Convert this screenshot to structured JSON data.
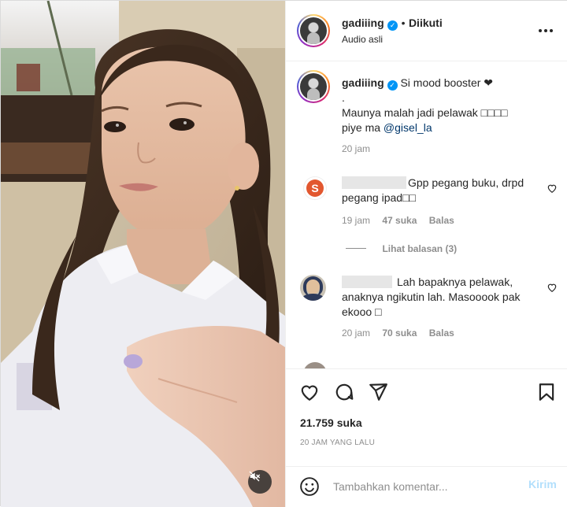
{
  "header": {
    "username": "gadiiing",
    "separator": "•",
    "follow_status": "Diikuti",
    "audio": "Audio asli",
    "more_icon": "more-horizontal-icon"
  },
  "caption": {
    "username": "gadiiing",
    "text_line1": "Si mood booster ❤",
    "text_dot": ".",
    "text_line2": "Maunya malah jadi pelawak □□□□",
    "text_line3_prefix": "piye ma ",
    "mention": "@gisel_la",
    "time": "20 jam"
  },
  "comments": [
    {
      "text_line1": "Gpp pegang buku, drpd",
      "text_line2": "pegang ipad□□",
      "time": "19 jam",
      "likes": "47 suka",
      "reply": "Balas",
      "view_replies": "Lihat balasan (3)"
    },
    {
      "text_line1": "Lah bapaknya pelawak,",
      "text_line2": "anaknya ngikutin lah. Masooook pak",
      "text_line3": "ekooo □",
      "time": "20 jam",
      "likes": "70 suka",
      "reply": "Balas"
    }
  ],
  "actions": {
    "icons": [
      "heart-icon",
      "comment-icon",
      "share-icon",
      "bookmark-icon"
    ],
    "likes_count": "21.759 suka",
    "posted_ago": "20 JAM YANG LALU"
  },
  "composer": {
    "placeholder": "Tambahkan komentar...",
    "post_label": "Kirim",
    "emoji_icon": "emoji-icon"
  },
  "video": {
    "mute_icon": "volume-muted-icon"
  },
  "colors": {
    "verified_blue": "#0095f6",
    "mention_blue": "#00376b",
    "post_button_disabled": "#b2dffc",
    "muted_text": "#8e8e8e"
  }
}
